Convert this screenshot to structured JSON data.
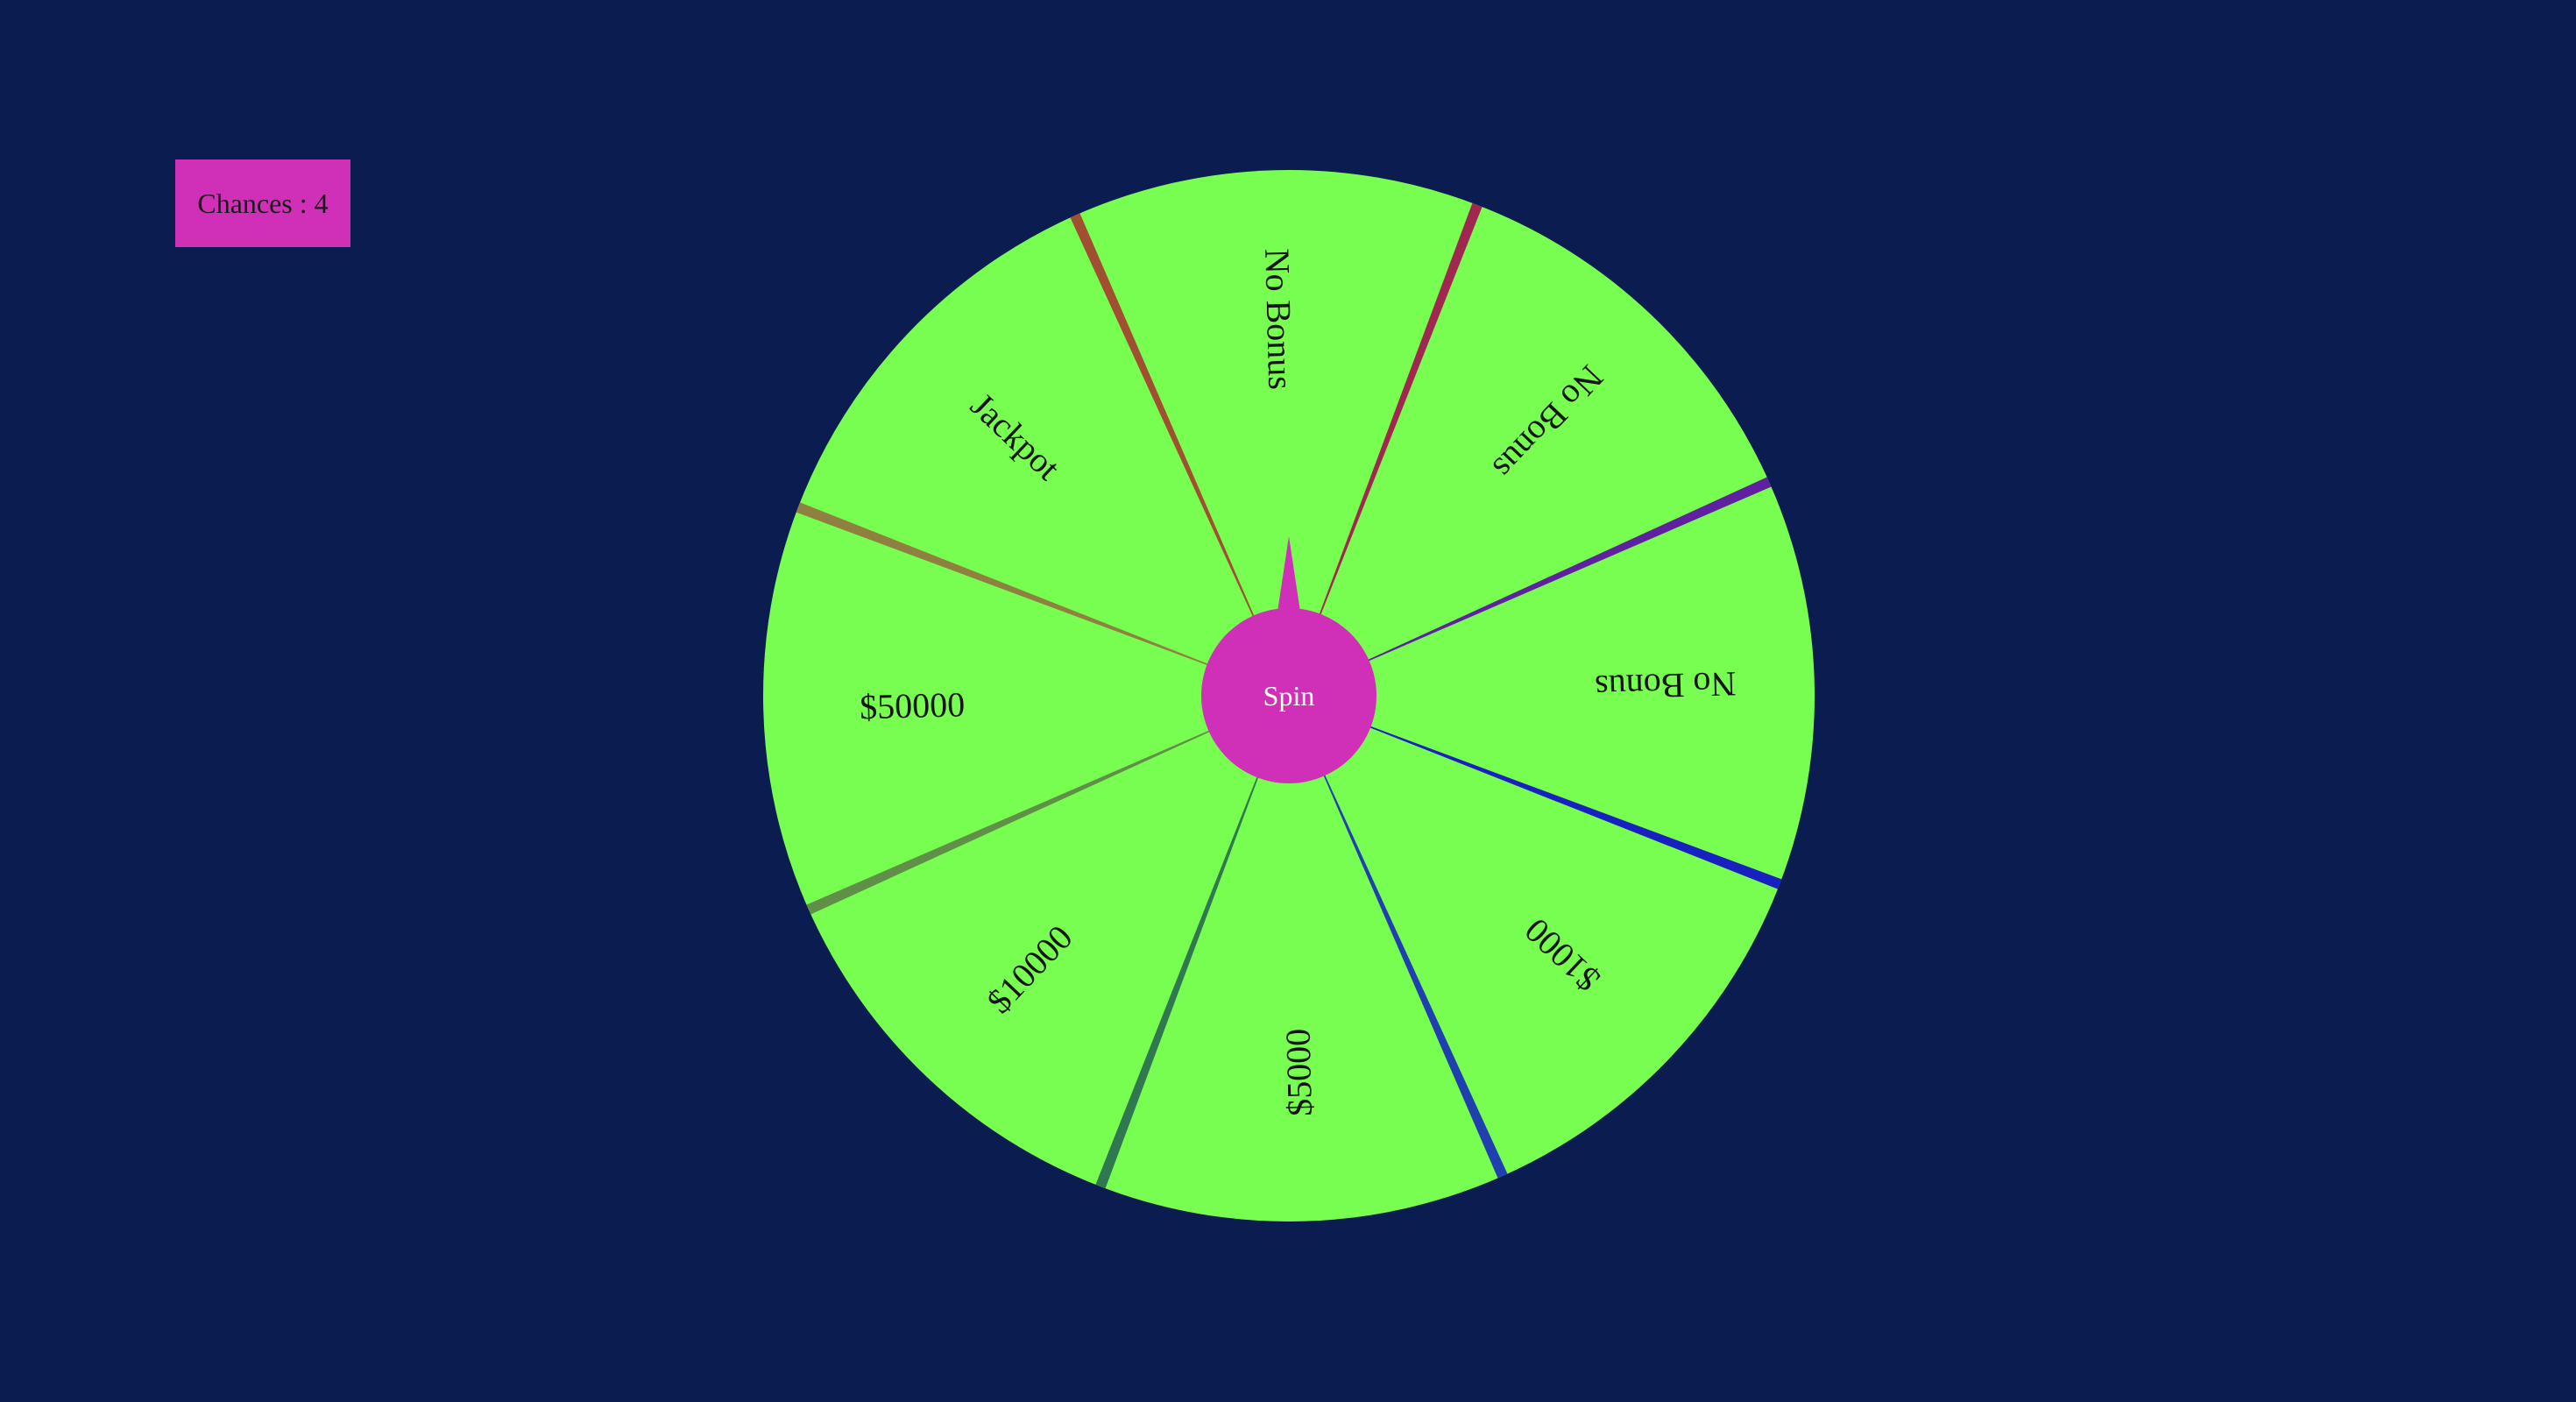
{
  "chances": {
    "label": "Chances : 4"
  },
  "wheel": {
    "spin_label": "Spin",
    "colors": {
      "segment_fill": "#78fe50",
      "center_fill": "#d030b8",
      "background": "#0a1c50"
    },
    "segments": [
      {
        "label": "No Bonus"
      },
      {
        "label": "No Bonus"
      },
      {
        "label": "No Bonus"
      },
      {
        "label": "$1000"
      },
      {
        "label": "$5000"
      },
      {
        "label": "$10000"
      },
      {
        "label": "$50000"
      },
      {
        "label": "Jackpot"
      }
    ],
    "dividers": [
      {
        "color": "#a05030"
      },
      {
        "color": "#a02850"
      },
      {
        "color": "#6020a0"
      },
      {
        "color": "#1820c0"
      },
      {
        "color": "#2040b0"
      },
      {
        "color": "#307850"
      },
      {
        "color": "#609048"
      },
      {
        "color": "#908040"
      }
    ]
  }
}
